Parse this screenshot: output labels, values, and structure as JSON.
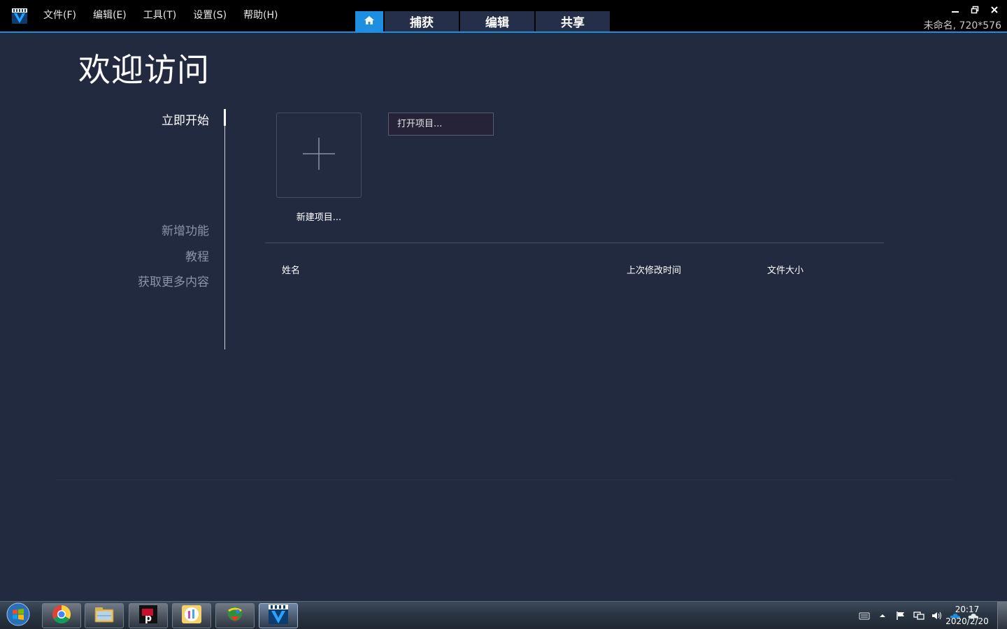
{
  "menubar": {
    "items": [
      "文件(F)",
      "编辑(E)",
      "工具(T)",
      "设置(S)",
      "帮助(H)"
    ]
  },
  "tabs": {
    "home_icon": "home-icon",
    "capture": "捕获",
    "edit": "编辑",
    "share": "共享"
  },
  "window": {
    "project_info": "未命名, 720*576"
  },
  "welcome": {
    "title": "欢迎访问",
    "nav": {
      "start_now": "立即开始",
      "new_features": "新增功能",
      "tutorials": "教程",
      "get_more": "获取更多内容"
    },
    "new_project_label": "新建项目...",
    "open_project_label": "打开项目...",
    "columns": {
      "name": "姓名",
      "modified": "上次修改时间",
      "size": "文件大小"
    }
  },
  "taskbar": {
    "apps": [
      "chrome-icon",
      "file-explorer-icon",
      "mp-app-icon",
      "i1-app-icon",
      "downloader-icon",
      "video-studio-icon"
    ],
    "clock_time": "20:17",
    "clock_date": "2020/2/20"
  },
  "colors": {
    "accent": "#1e8fe0",
    "background": "#222a40",
    "titlebar": "#000000",
    "tab": "#262f4a"
  }
}
